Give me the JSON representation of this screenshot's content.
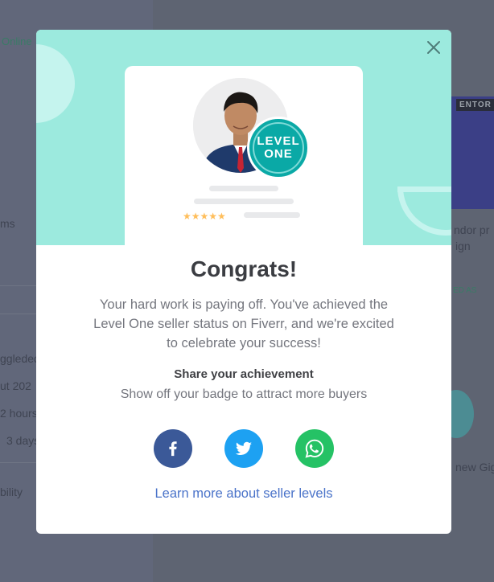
{
  "background": {
    "texts": [
      "Online",
      "ms",
      "ggleded",
      "ut 202",
      "2 hours",
      "3 days",
      "bility",
      "ndor pr",
      "ign",
      "ED AS",
      "new Gig"
    ],
    "thumb_tag": "ENTOR"
  },
  "modal": {
    "close_icon": "close-icon",
    "badge": {
      "line1": "LEVEL",
      "line2": "ONE",
      "stars": "★★★★★",
      "rating": 5
    },
    "title": "Congrats!",
    "message": "Your hard work is paying off. You've achieved the Level One seller status on Fiverr, and we're excited to celebrate your success!",
    "share_title": "Share your achievement",
    "share_subtitle": "Show off your badge to attract more buyers",
    "social": [
      {
        "name": "facebook",
        "icon": "facebook-icon",
        "color": "#3b5998"
      },
      {
        "name": "twitter",
        "icon": "twitter-icon",
        "color": "#1da1f2"
      },
      {
        "name": "whatsapp",
        "icon": "whatsapp-icon",
        "color": "#25c265"
      }
    ],
    "learn_more": "Learn more about seller levels"
  },
  "colors": {
    "header_bg": "#9ceade",
    "badge": "#0aa9a6",
    "link": "#4a73c9",
    "star": "#ffbe5b"
  }
}
